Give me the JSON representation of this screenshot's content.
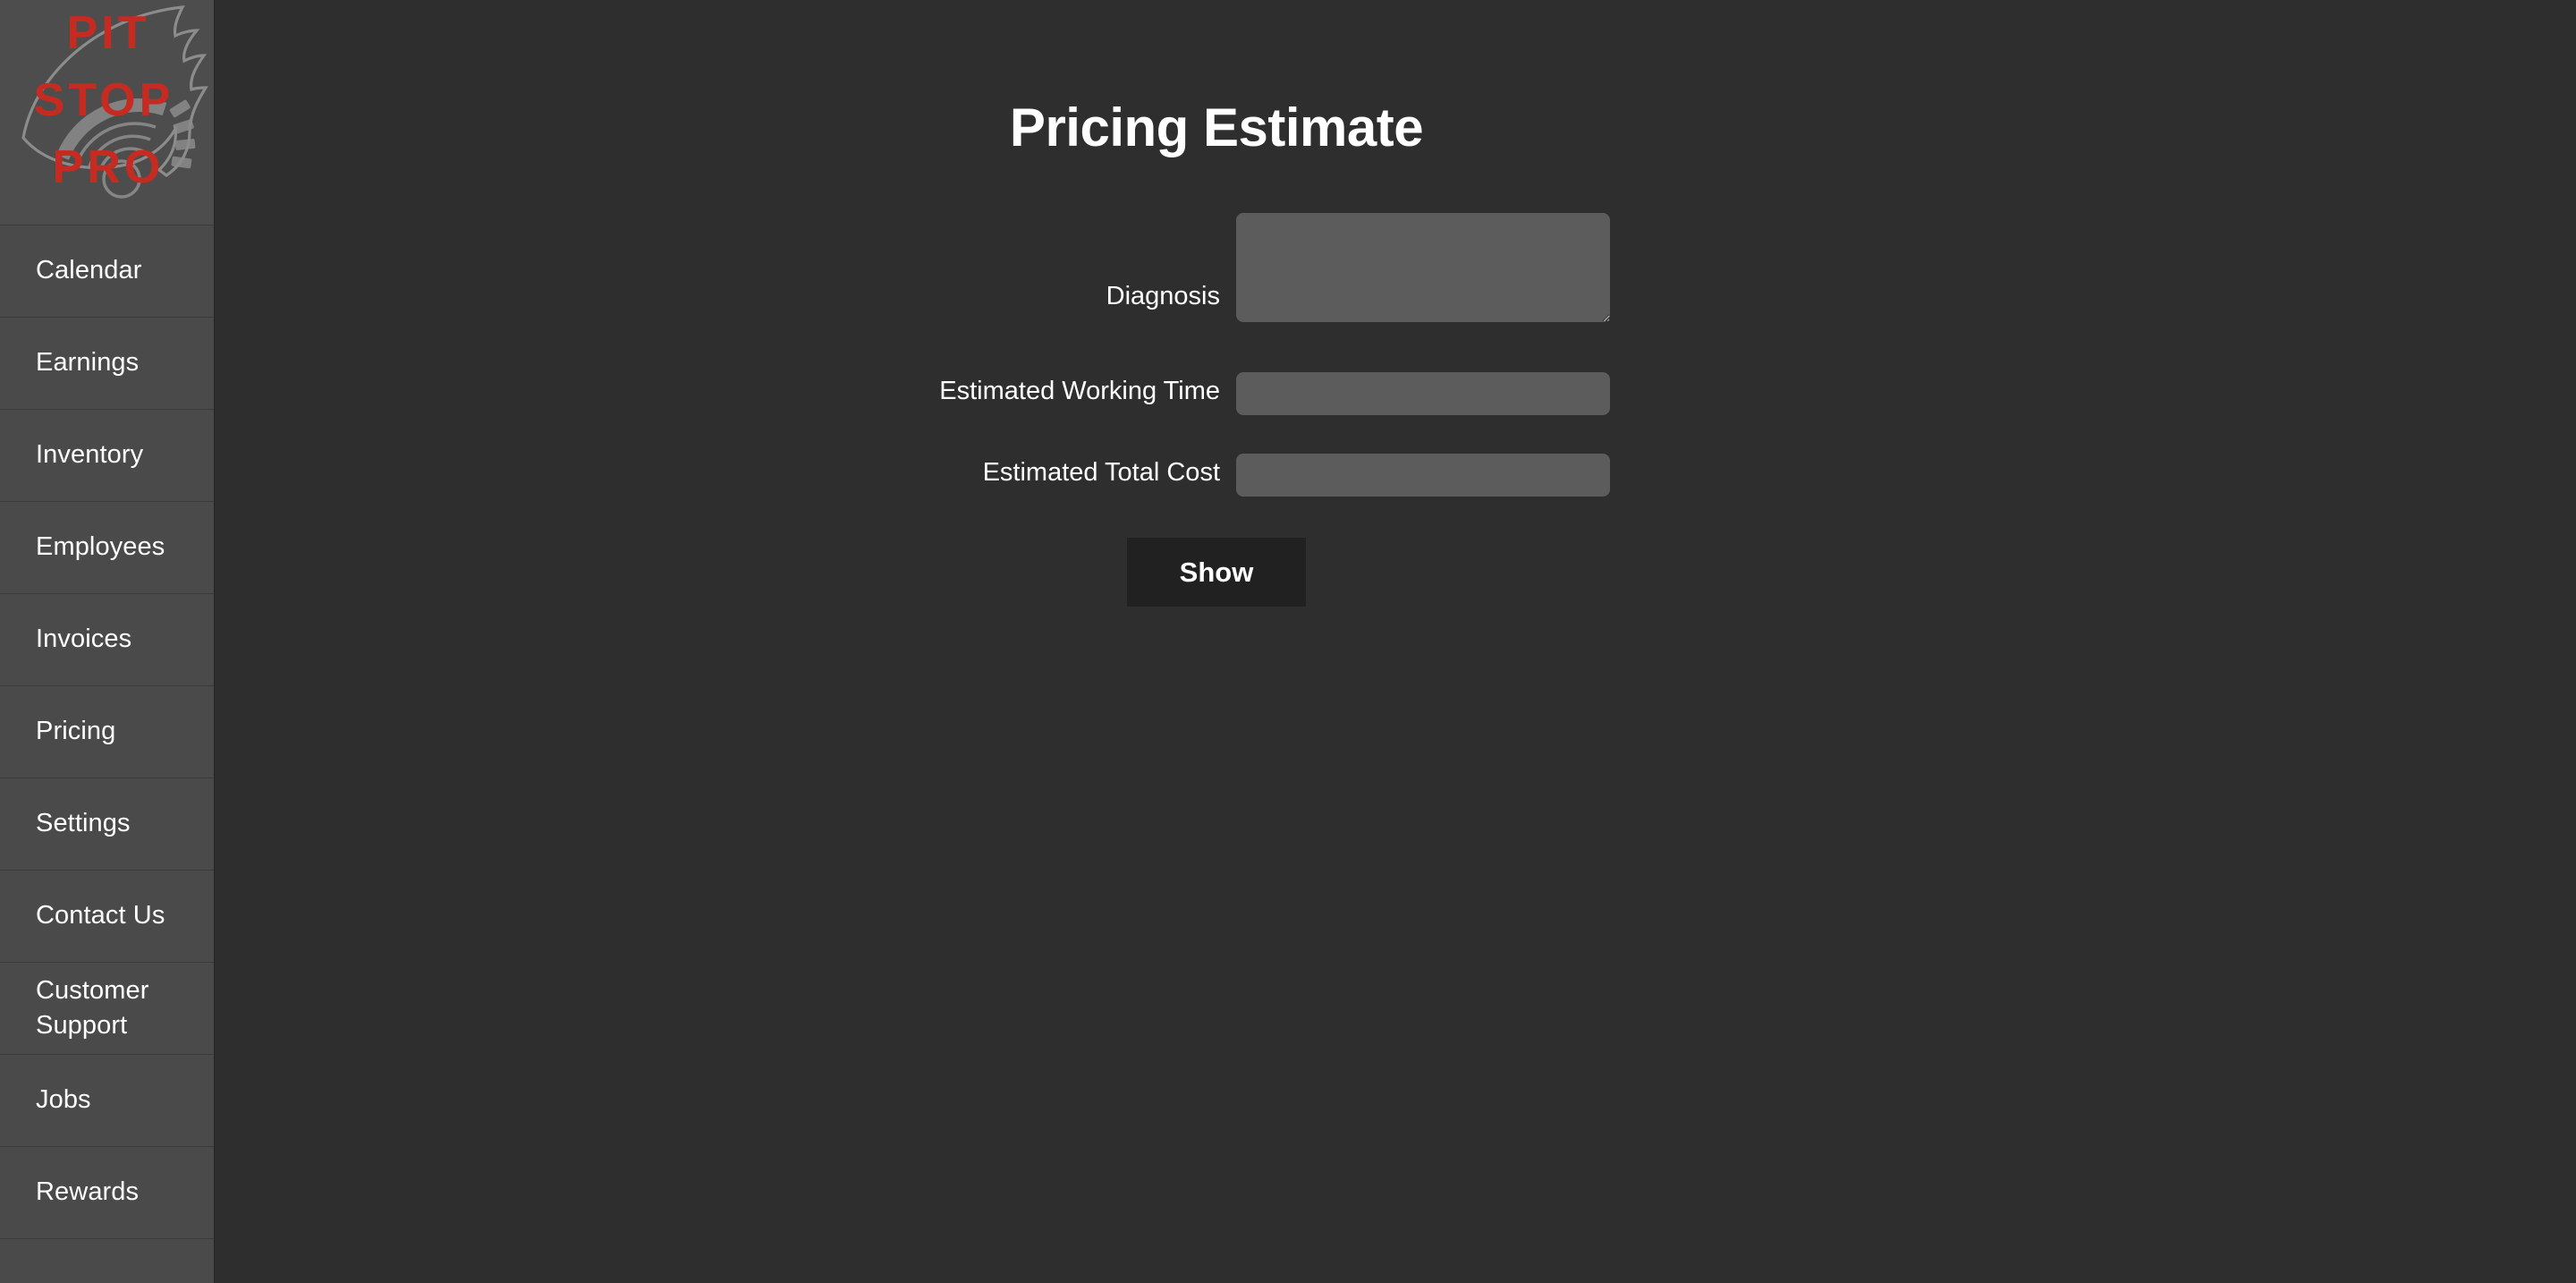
{
  "brand": {
    "logo_line1": "PIT",
    "logo_line2": "STOP",
    "logo_line3": "PRO",
    "logo_text_color": "#c62b22",
    "logo_graphic_color": "#8c8c8c"
  },
  "theme": {
    "sidebar_bg": "#4a4a4a",
    "main_bg": "#2e2e2e",
    "field_bg": "#5c5c5c",
    "button_bg": "#212121",
    "text_color": "#ffffff"
  },
  "sidebar": {
    "items": [
      {
        "label": "Calendar"
      },
      {
        "label": "Earnings"
      },
      {
        "label": "Inventory"
      },
      {
        "label": "Employees"
      },
      {
        "label": "Invoices"
      },
      {
        "label": "Pricing"
      },
      {
        "label": "Settings"
      },
      {
        "label": "Contact Us"
      },
      {
        "label": "Customer Support"
      },
      {
        "label": "Jobs"
      },
      {
        "label": "Rewards"
      }
    ]
  },
  "main": {
    "title": "Pricing Estimate",
    "fields": [
      {
        "label": "Diagnosis",
        "value": "",
        "placeholder": "",
        "type": "textarea"
      },
      {
        "label": "Estimated Working Time",
        "value": "",
        "placeholder": "",
        "type": "text"
      },
      {
        "label": "Estimated Total Cost",
        "value": "",
        "placeholder": "",
        "type": "text"
      }
    ],
    "submit_label": "Show"
  }
}
